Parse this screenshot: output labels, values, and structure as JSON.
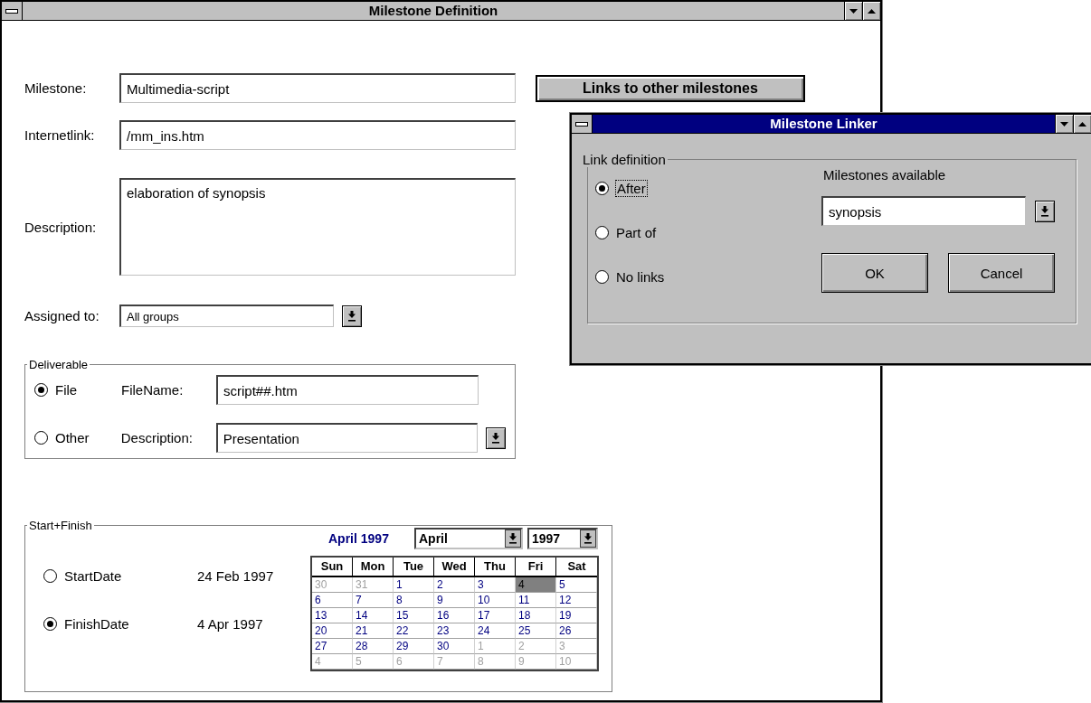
{
  "main_window": {
    "title": "Milestone Definition",
    "active": false
  },
  "milestone": {
    "label": "Milestone:",
    "value": "Multimedia-script"
  },
  "links_button": "Links to other milestones",
  "internetlink": {
    "label": "Internetlink:",
    "value": "/mm_ins.htm"
  },
  "description": {
    "label": "Description:",
    "value": "elaboration of synopsis"
  },
  "assigned_to": {
    "label": "Assigned to:",
    "value": "All groups"
  },
  "deliverable": {
    "title": "Deliverable",
    "options": [
      {
        "label": "File",
        "selected": true
      },
      {
        "label": "Other",
        "selected": false
      }
    ],
    "filename": {
      "label": "FileName:",
      "value": "script##.htm"
    },
    "description": {
      "label": "Description:",
      "value": "Presentation"
    }
  },
  "start_finish": {
    "title": "Start+Finish",
    "dates": [
      {
        "label": "StartDate",
        "value": "24 Feb 1997",
        "selected": false
      },
      {
        "label": "FinishDate",
        "value": "4 Apr 1997",
        "selected": true
      }
    ],
    "calendar": {
      "caption": "April 1997",
      "month": "April",
      "year": "1997",
      "weekdays": [
        "Sun",
        "Mon",
        "Tue",
        "Wed",
        "Thu",
        "Fri",
        "Sat"
      ],
      "weeks": [
        [
          {
            "day": "30",
            "in_month": false,
            "selected": false
          },
          {
            "day": "31",
            "in_month": false,
            "selected": false
          },
          {
            "day": "1",
            "in_month": true,
            "selected": false
          },
          {
            "day": "2",
            "in_month": true,
            "selected": false
          },
          {
            "day": "3",
            "in_month": true,
            "selected": false
          },
          {
            "day": "4",
            "in_month": true,
            "selected": true
          },
          {
            "day": "5",
            "in_month": true,
            "selected": false
          }
        ],
        [
          {
            "day": "6",
            "in_month": true,
            "selected": false
          },
          {
            "day": "7",
            "in_month": true,
            "selected": false
          },
          {
            "day": "8",
            "in_month": true,
            "selected": false
          },
          {
            "day": "9",
            "in_month": true,
            "selected": false
          },
          {
            "day": "10",
            "in_month": true,
            "selected": false
          },
          {
            "day": "11",
            "in_month": true,
            "selected": false
          },
          {
            "day": "12",
            "in_month": true,
            "selected": false
          }
        ],
        [
          {
            "day": "13",
            "in_month": true,
            "selected": false
          },
          {
            "day": "14",
            "in_month": true,
            "selected": false
          },
          {
            "day": "15",
            "in_month": true,
            "selected": false
          },
          {
            "day": "16",
            "in_month": true,
            "selected": false
          },
          {
            "day": "17",
            "in_month": true,
            "selected": false
          },
          {
            "day": "18",
            "in_month": true,
            "selected": false
          },
          {
            "day": "19",
            "in_month": true,
            "selected": false
          }
        ],
        [
          {
            "day": "20",
            "in_month": true,
            "selected": false
          },
          {
            "day": "21",
            "in_month": true,
            "selected": false
          },
          {
            "day": "22",
            "in_month": true,
            "selected": false
          },
          {
            "day": "23",
            "in_month": true,
            "selected": false
          },
          {
            "day": "24",
            "in_month": true,
            "selected": false
          },
          {
            "day": "25",
            "in_month": true,
            "selected": false
          },
          {
            "day": "26",
            "in_month": true,
            "selected": false
          }
        ],
        [
          {
            "day": "27",
            "in_month": true,
            "selected": false
          },
          {
            "day": "28",
            "in_month": true,
            "selected": false
          },
          {
            "day": "29",
            "in_month": true,
            "selected": false
          },
          {
            "day": "30",
            "in_month": true,
            "selected": false
          },
          {
            "day": "1",
            "in_month": false,
            "selected": false
          },
          {
            "day": "2",
            "in_month": false,
            "selected": false
          },
          {
            "day": "3",
            "in_month": false,
            "selected": false
          }
        ],
        [
          {
            "day": "4",
            "in_month": false,
            "selected": false
          },
          {
            "day": "5",
            "in_month": false,
            "selected": false
          },
          {
            "day": "6",
            "in_month": false,
            "selected": false
          },
          {
            "day": "7",
            "in_month": false,
            "selected": false
          },
          {
            "day": "8",
            "in_month": false,
            "selected": false
          },
          {
            "day": "9",
            "in_month": false,
            "selected": false
          },
          {
            "day": "10",
            "in_month": false,
            "selected": false
          }
        ]
      ]
    }
  },
  "linker": {
    "title": "Milestone Linker",
    "active": true,
    "group_title": "Link definition",
    "options": [
      {
        "label": "After",
        "selected": true
      },
      {
        "label": "Part of",
        "selected": false
      },
      {
        "label": "No links",
        "selected": false
      }
    ],
    "available_label": "Milestones available",
    "available_value": "synopsis",
    "buttons": [
      "OK",
      "Cancel"
    ]
  }
}
